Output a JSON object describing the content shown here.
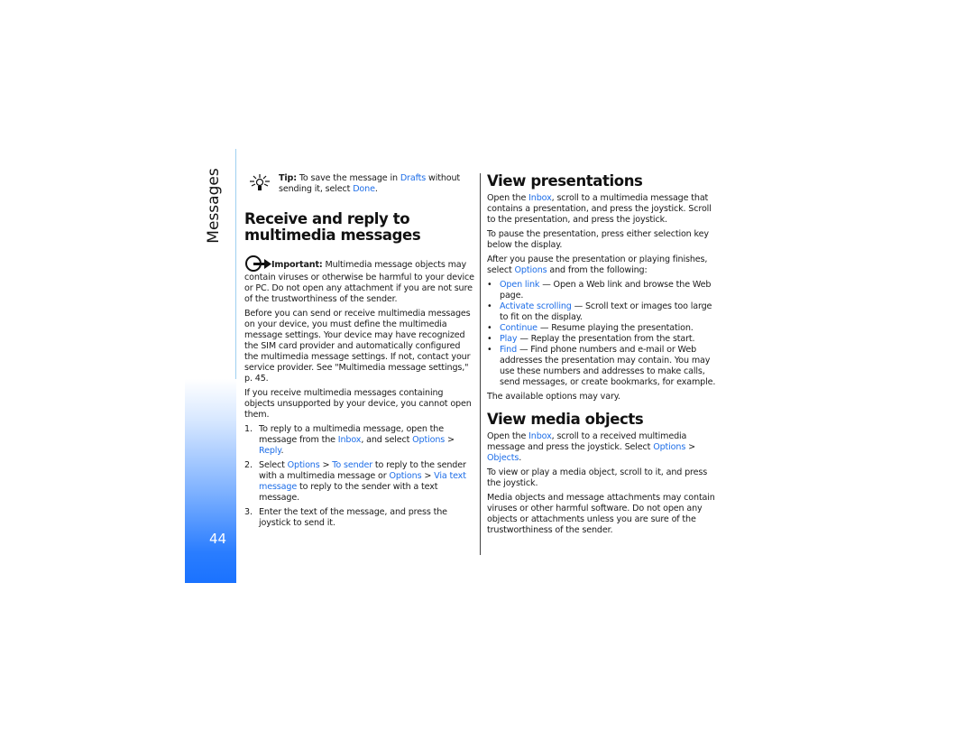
{
  "section_tab": {
    "label": "Messages",
    "page_number": "44"
  },
  "colors": {
    "link": "#1e6ee8",
    "tab_gradient_bottom": "#1a72ff",
    "tab_line": "#9fd0f0"
  },
  "left": {
    "tip": {
      "icon": "lightbulb-icon",
      "label": "Tip:",
      "t1": " To save the message in ",
      "l1": "Drafts",
      "t2": " without sending it, select ",
      "l2": "Done",
      "t3": "."
    },
    "heading": "Receive and reply to multimedia messages",
    "important": {
      "icon": "important-icon",
      "label": "Important:",
      "text": "  Multimedia message objects may contain viruses or otherwise be harmful to your device or PC. Do not open any attachment if you are not sure of the trustworthiness of the sender."
    },
    "para1": "Before you can send or receive multimedia messages on your device, you must define the multimedia message settings. Your device may have recognized the SIM card provider and automatically configured the multimedia message settings. If not, contact your service provider. See \"Multimedia message settings,\" p. 45.",
    "para2": "If you receive multimedia messages containing objects unsupported by your device, you cannot open them.",
    "steps": [
      {
        "num": "1.",
        "t1": "To reply to a multimedia message, open the message from the ",
        "l1": "Inbox",
        "t2": ", and select ",
        "l2": "Options",
        "t3": " > ",
        "l3": "Reply",
        "t4": "."
      },
      {
        "num": "2.",
        "t1": "Select ",
        "l1": "Options",
        "t2": " > ",
        "l2": "To sender",
        "t3": " to reply to the sender with a multimedia message or ",
        "l3": "Options",
        "t4": " > ",
        "l4": "Via text message",
        "t5": " to reply to the sender with a text message."
      },
      {
        "num": "3.",
        "t1": "Enter the text of the message, and press the joystick to send it."
      }
    ]
  },
  "right": {
    "presentations": {
      "heading": "View presentations",
      "p1": {
        "t1": "Open the ",
        "l1": "Inbox",
        "t2": ", scroll to a multimedia message that contains a presentation, and press the joystick. Scroll to the presentation, and press the joystick."
      },
      "p2": "To pause the presentation, press either selection key below the display.",
      "p3": {
        "t1": "After you pause the presentation or playing finishes, select ",
        "l1": "Options",
        "t2": " and from the following:"
      },
      "options": [
        {
          "label": "Open link",
          "desc": " — Open a Web link and browse the Web page."
        },
        {
          "label": "Activate scrolling",
          "desc": " — Scroll text or images too large to fit on the display."
        },
        {
          "label": "Continue",
          "desc": " — Resume playing the presentation."
        },
        {
          "label": "Play",
          "desc": " — Replay the presentation from the start."
        },
        {
          "label": "Find",
          "desc": " — Find phone numbers and e-mail or Web addresses the presentation may contain. You may use these numbers and addresses to make calls, send messages, or create bookmarks, for example."
        }
      ],
      "note": "The available options may vary."
    },
    "media": {
      "heading": "View media objects",
      "p1": {
        "t1": "Open the ",
        "l1": "Inbox",
        "t2": ", scroll to a received multimedia message and press the joystick. Select ",
        "l2": "Options",
        "t3": " > ",
        "l3": "Objects",
        "t4": "."
      },
      "p2": "To view or play a media object, scroll to it, and press the joystick.",
      "p3": "Media objects and message attachments may contain viruses or other harmful software. Do not open any objects or attachments unless you are sure of the trustworthiness of the sender."
    }
  }
}
